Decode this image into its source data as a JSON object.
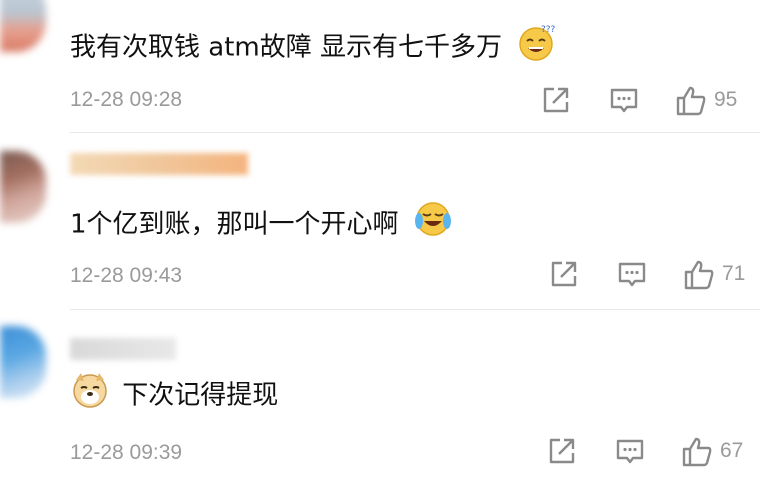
{
  "comments": [
    {
      "text": "我有次取钱  atm故障 显示有七千多万",
      "emoji": "grinning-sweat-emoji",
      "timestamp": "12-28 09:28",
      "likes": "95"
    },
    {
      "text": "1个亿到账，那叫一个开心啊",
      "emoji": "laugh-cry-emoji",
      "timestamp": "12-28 09:43",
      "likes": "71"
    },
    {
      "text": "下次记得提现",
      "emoji": "doge-emoji",
      "timestamp": "12-28 09:39",
      "likes": "67"
    }
  ],
  "icons": {
    "share": "share-icon",
    "reply": "reply-icon",
    "like": "thumbs-up-icon"
  },
  "colors": {
    "meta_gray": "#9a9a9a",
    "text": "#111111",
    "divider": "#e8e8e8"
  }
}
